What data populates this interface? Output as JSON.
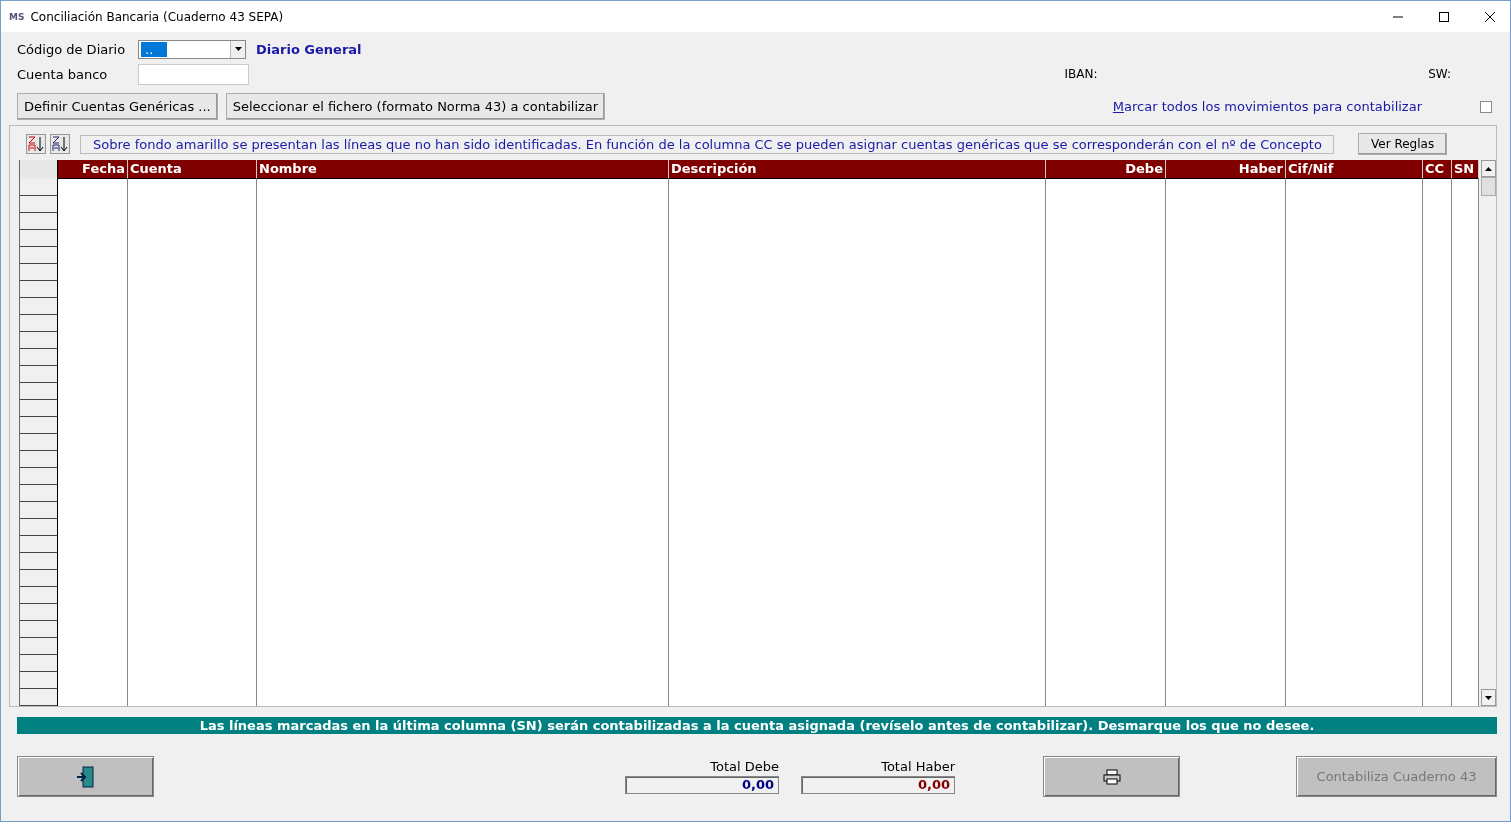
{
  "window": {
    "title": "Conciliación Bancaria (Cuaderno 43 SEPA)",
    "logo": "MS"
  },
  "form": {
    "diario_label": "Código de Diario",
    "diario_value": "..",
    "diario_value_selected": true,
    "diario_name": "Diario General",
    "cuenta_label": "Cuenta banco",
    "iban_label": "IBAN:",
    "sw_label": "SW:"
  },
  "buttons": [
    {
      "label": "Definir Cuentas Genéricas ..."
    },
    {
      "label": "Seleccionar el fichero (formato Norma 43) a contabilizar"
    }
  ],
  "mark_all": {
    "label_first": "M",
    "label_rest": "arcar todos los movimientos para contabilizar",
    "checked": false
  },
  "info_text": "Sobre fondo amarillo se presentan las líneas que no han sido identificadas. En función de la columna CC se pueden asignar cuentas genéricas que se corresponderán con el nº de Concepto",
  "rules_button": "Ver Reglas",
  "table": {
    "columns": [
      {
        "label": "Fecha"
      },
      {
        "label": "Cuenta"
      },
      {
        "label": "Nombre"
      },
      {
        "label": "Descripción"
      },
      {
        "label": "Debe"
      },
      {
        "label": "Haber"
      },
      {
        "label": "Cif/Nif"
      },
      {
        "label": "CC"
      },
      {
        "label": "SN"
      }
    ]
  },
  "notice": "Las líneas marcadas en la última columna (SN) serán contabilizadas a la cuenta asignada (revíselo antes de contabilizar). Desmarque los que no desee.",
  "totals": [
    {
      "label": "Total Debe",
      "value": "0,00",
      "kind": "debe"
    },
    {
      "label": "Total Haber",
      "value": "0,00",
      "kind": "haber"
    }
  ],
  "post_button": {
    "label": "Contabiliza Cuaderno 43",
    "disabled": true
  }
}
